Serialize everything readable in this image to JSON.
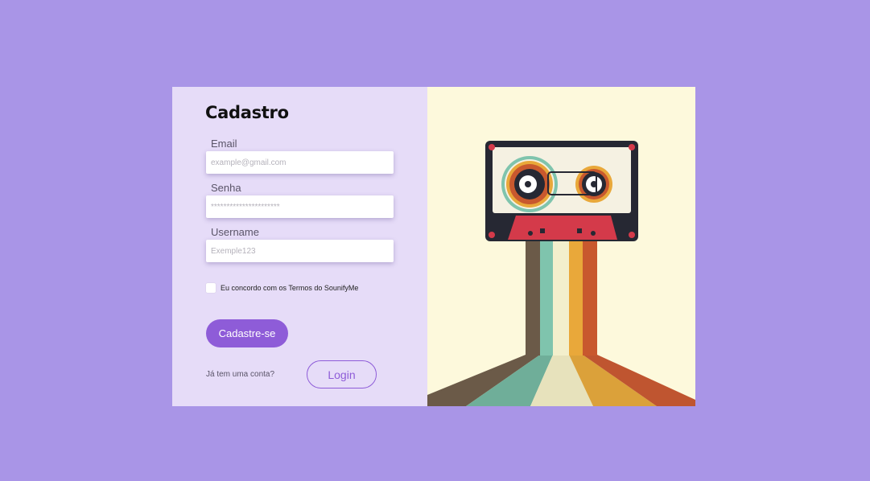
{
  "form": {
    "title": "Cadastro",
    "email": {
      "label": "Email",
      "placeholder": "example@gmail.com"
    },
    "password": {
      "label": "Senha",
      "placeholder": "**********************"
    },
    "username": {
      "label": "Username",
      "placeholder": "Exemple123"
    },
    "terms_text": "Eu concordo com os Termos  do SounifyMe",
    "terms_checked": false,
    "submit_label": "Cadastre-se",
    "have_account_text": "Já tem uma conta?",
    "login_label": "Login"
  },
  "colors": {
    "page_background": "#a995e7",
    "form_background": "#e6dcf8",
    "art_background": "#fdf9dc",
    "accent": "#8e5cd8"
  },
  "illustration": {
    "icon": "retro-cassette-tape-icon",
    "stripe_colors": [
      "#6b5a48",
      "#7fc4ad",
      "#ede8c4",
      "#e9a83a",
      "#c8582e"
    ]
  }
}
